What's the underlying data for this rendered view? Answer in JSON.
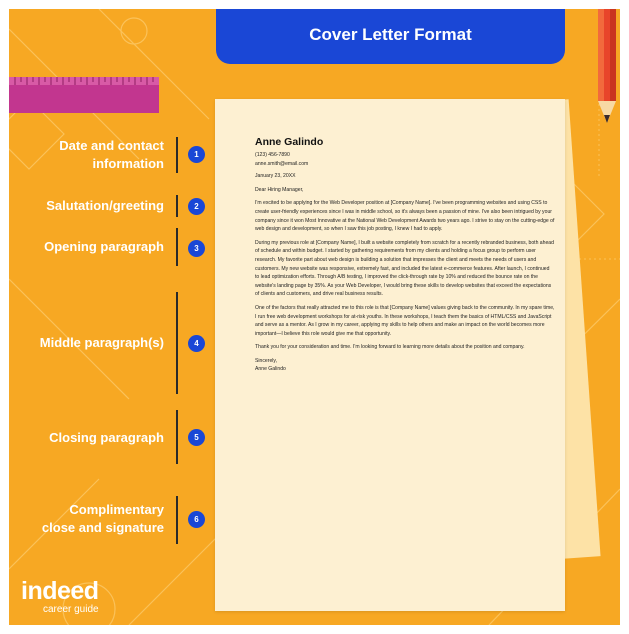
{
  "title": "Cover Letter Format",
  "colors": {
    "background": "#f7a823",
    "banner": "#1a47d6",
    "badge": "#1a47d6",
    "paper": "#fdf0d2",
    "ruler": "#c2368f",
    "pencil": "#e8452a"
  },
  "sections": [
    {
      "label_lines": [
        "Date and contact",
        "information"
      ],
      "number": "1"
    },
    {
      "label_lines": [
        "Salutation/greeting"
      ],
      "number": "2"
    },
    {
      "label_lines": [
        "Opening paragraph"
      ],
      "number": "3"
    },
    {
      "label_lines": [
        "Middle paragraph(s)"
      ],
      "number": "4"
    },
    {
      "label_lines": [
        "Closing paragraph"
      ],
      "number": "5"
    },
    {
      "label_lines": [
        "Complimentary",
        "close and signature"
      ],
      "number": "6"
    }
  ],
  "letter": {
    "name": "Anne Galindo",
    "phone": "(123) 456-7890",
    "email": "anne.smith@email.com",
    "date": "January 23, 20XX",
    "salutation": "Dear Hiring Manager,",
    "opening": "I'm excited to be applying for the Web Developer position at [Company Name]. I've been programming websites and using CSS to create user-friendly experiences since I was in middle school, so it's always been a passion of mine. I've also been intrigued by your company since it won Most Innovative at the National Web Development Awards two years ago. I strive to stay on the cutting-edge of web design and development, so when I saw this job posting, I knew I had to apply.",
    "middle": "During my previous role at [Company Name], I built a website completely from scratch for a recently rebranded business, both ahead of schedule and within budget. I started by gathering requirements from my clients and holding a focus group to perform user research. My favorite part about web design is building a solution that impresses the client and meets the needs of users and customers. My new website was responsive, extremely fast, and included the latest e-commerce features. After launch, I continued to lead optimization efforts. Through A/B testing, I improved the click-through rate by 10% and reduced the bounce rate on the website's landing page by 35%. As your Web Developer, I would bring these skills to develop websites that exceed the expectations of clients and customers, and drive real business results.",
    "closing1": "One of the factors that really attracted me to this role is that [Company Name] values giving back to the community. In my spare time, I run free web development workshops for at-risk youths. In these workshops, I teach them the basics of HTML/CSS and JavaScript and serve as a mentor. As I grow in my career, applying my skills to help others and make an impact on the world becomes more important—I believe this role would give me that opportunity.",
    "closing2": "Thank you for your consideration and time. I'm looking forward to learning more details about the position and company.",
    "signoff": "Sincerely,",
    "signature": "Anne Galindo"
  },
  "logo": {
    "word": "indeed",
    "tagline": "career guide"
  }
}
